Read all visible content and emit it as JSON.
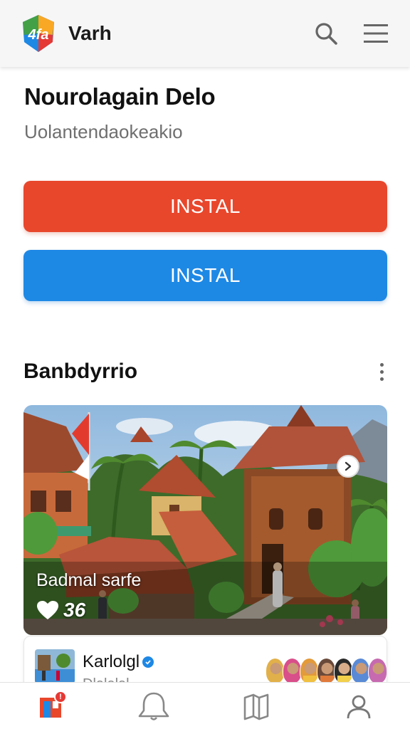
{
  "app": {
    "brand": "Varh",
    "logo_text": "4fa"
  },
  "header": {
    "search_icon": "search-icon",
    "menu_icon": "hamburger-menu-icon"
  },
  "hero": {
    "title": "Nourolagain Delo",
    "subtitle": "Uolantendaokeakio"
  },
  "buttons": {
    "primary_label": "INSTAL",
    "secondary_label": "INSTAL"
  },
  "section": {
    "title": "Banbdyrrio",
    "more_icon": "kebab-menu-icon"
  },
  "feature_card": {
    "caption": "Badmal sarfe",
    "likes": "36",
    "image": "traditional-village-houses-image"
  },
  "peek_card": {
    "name": "Karlolgl",
    "subtitle": "Dlalalal"
  },
  "bottom_nav": {
    "items": [
      {
        "name": "home",
        "icon": "home-tile-icon",
        "badge": "!"
      },
      {
        "name": "notifications",
        "icon": "bell-icon"
      },
      {
        "name": "library",
        "icon": "book-icon"
      },
      {
        "name": "profile",
        "icon": "user-icon"
      }
    ]
  },
  "colors": {
    "primary_red": "#e8472c",
    "primary_blue": "#1e88e5",
    "header_bg": "#f6f6f6"
  }
}
